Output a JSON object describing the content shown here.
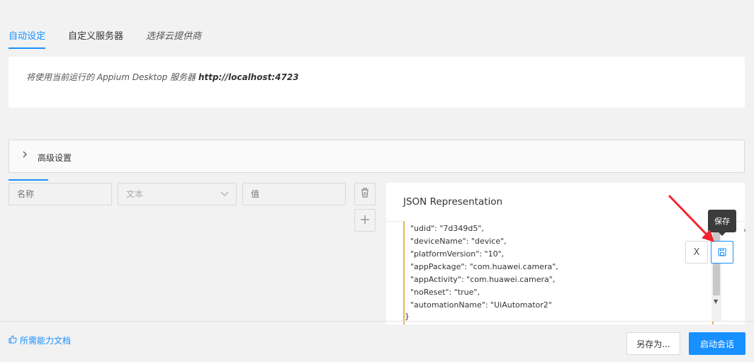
{
  "tabs": [
    {
      "label": "自动设定"
    },
    {
      "label": "自定义服务器"
    },
    {
      "label": "选择云提供商"
    }
  ],
  "info": {
    "prefix": "将使用当前运行的 Appium Desktop 服务器 ",
    "url": "http://localhost:4723"
  },
  "advanced": {
    "label": "高级设置"
  },
  "capability_row": {
    "name_placeholder": "名称",
    "type_value": "文本",
    "value_placeholder": "值"
  },
  "json_panel": {
    "title": "JSON Representation",
    "lines": [
      "\"udid\": \"7d349d5\",",
      "\"deviceName\": \"device\",",
      "\"platformVersion\": \"10\",",
      "\"appPackage\": \"com.huawei.camera\",",
      "\"appActivity\": \"com.huawei.camera\",",
      "\"noReset\": \"true\",",
      "\"automationName\": \"UiAutomator2\"",
      "}"
    ],
    "tooltip": "保存",
    "clear_label": "X"
  },
  "footer": {
    "doc_link": "所需能力文档",
    "save_as": "另存为...",
    "start": "启动会话"
  },
  "colors": {
    "accent": "#1890ff",
    "arrow": "#f5222d"
  }
}
